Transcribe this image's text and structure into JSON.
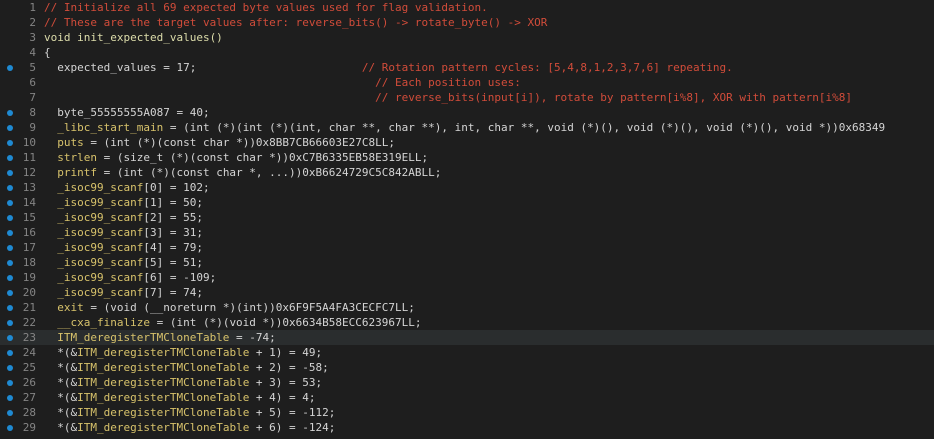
{
  "editor": {
    "lines": [
      {
        "n": "1",
        "bp": false,
        "current": false,
        "segments": [
          {
            "t": "// Initialize all 69 expected byte values used for flag validation.",
            "c": "comment"
          }
        ]
      },
      {
        "n": "2",
        "bp": false,
        "current": false,
        "segments": [
          {
            "t": "// These are the target values after: reverse_bits() -> rotate_byte() -> XOR",
            "c": "comment"
          }
        ]
      },
      {
        "n": "3",
        "bp": false,
        "current": false,
        "segments": [
          {
            "t": "void init_expected_values()",
            "c": "kw"
          }
        ]
      },
      {
        "n": "4",
        "bp": false,
        "current": false,
        "segments": [
          {
            "t": "{",
            "c": "plain"
          }
        ]
      },
      {
        "n": "5",
        "bp": true,
        "current": false,
        "segments": [
          {
            "t": "  expected_values = 17;",
            "c": "plain"
          },
          {
            "t": "                         // Rotation pattern cycles: [5,4,8,1,2,3,7,6] repeating.",
            "c": "comment"
          }
        ]
      },
      {
        "n": "6",
        "bp": false,
        "current": false,
        "segments": [
          {
            "t": "                                                  // Each position uses:",
            "c": "comment"
          }
        ]
      },
      {
        "n": "7",
        "bp": false,
        "current": false,
        "segments": [
          {
            "t": "                                                  // reverse_bits(input[i]), rotate by pattern[i%8], XOR with pattern[i%8]",
            "c": "comment"
          }
        ]
      },
      {
        "n": "8",
        "bp": true,
        "current": false,
        "segments": [
          {
            "t": "  byte_55555555A087 = 40;",
            "c": "plain"
          }
        ]
      },
      {
        "n": "9",
        "bp": true,
        "current": false,
        "segments": [
          {
            "t": "  _libc_start_main",
            "c": "sym"
          },
          {
            "t": " = (int (*)(int (*)(int, char **, char **), int, char **, void (*)(), void (*)(), void (*)(), void *))0x68349",
            "c": "plain"
          }
        ]
      },
      {
        "n": "10",
        "bp": true,
        "current": false,
        "segments": [
          {
            "t": "  puts",
            "c": "sym"
          },
          {
            "t": " = (int (*)(const char *))0x8BB7CB66603E27C8LL;",
            "c": "plain"
          }
        ]
      },
      {
        "n": "11",
        "bp": true,
        "current": false,
        "segments": [
          {
            "t": "  strlen",
            "c": "sym"
          },
          {
            "t": " = (size_t (*)(const char *))0xC7B6335EB58E319ELL;",
            "c": "plain"
          }
        ]
      },
      {
        "n": "12",
        "bp": true,
        "current": false,
        "segments": [
          {
            "t": "  printf",
            "c": "sym"
          },
          {
            "t": " = (int (*)(const char *, ...))0xB6624729C5C842ABLL;",
            "c": "plain"
          }
        ]
      },
      {
        "n": "13",
        "bp": true,
        "current": false,
        "segments": [
          {
            "t": "  _isoc99_scanf",
            "c": "sym"
          },
          {
            "t": "[0] = 102;",
            "c": "plain"
          }
        ]
      },
      {
        "n": "14",
        "bp": true,
        "current": false,
        "segments": [
          {
            "t": "  _isoc99_scanf",
            "c": "sym"
          },
          {
            "t": "[1] = 50;",
            "c": "plain"
          }
        ]
      },
      {
        "n": "15",
        "bp": true,
        "current": false,
        "segments": [
          {
            "t": "  _isoc99_scanf",
            "c": "sym"
          },
          {
            "t": "[2] = 55;",
            "c": "plain"
          }
        ]
      },
      {
        "n": "16",
        "bp": true,
        "current": false,
        "segments": [
          {
            "t": "  _isoc99_scanf",
            "c": "sym"
          },
          {
            "t": "[3] = 31;",
            "c": "plain"
          }
        ]
      },
      {
        "n": "17",
        "bp": true,
        "current": false,
        "segments": [
          {
            "t": "  _isoc99_scanf",
            "c": "sym"
          },
          {
            "t": "[4] = 79;",
            "c": "plain"
          }
        ]
      },
      {
        "n": "18",
        "bp": true,
        "current": false,
        "segments": [
          {
            "t": "  _isoc99_scanf",
            "c": "sym"
          },
          {
            "t": "[5] = 51;",
            "c": "plain"
          }
        ]
      },
      {
        "n": "19",
        "bp": true,
        "current": false,
        "segments": [
          {
            "t": "  _isoc99_scanf",
            "c": "sym"
          },
          {
            "t": "[6] = -109;",
            "c": "plain"
          }
        ]
      },
      {
        "n": "20",
        "bp": true,
        "current": false,
        "segments": [
          {
            "t": "  _isoc99_scanf",
            "c": "sym"
          },
          {
            "t": "[7] = 74;",
            "c": "plain"
          }
        ]
      },
      {
        "n": "21",
        "bp": true,
        "current": false,
        "segments": [
          {
            "t": "  exit",
            "c": "sym"
          },
          {
            "t": " = (void (__noreturn *)(int))0x6F9F5A4FA3CECFC7LL;",
            "c": "plain"
          }
        ]
      },
      {
        "n": "22",
        "bp": true,
        "current": false,
        "segments": [
          {
            "t": "  __cxa_finalize",
            "c": "sym"
          },
          {
            "t": " = (int (*)(void *))0x6634B58ECC623967LL;",
            "c": "plain"
          }
        ]
      },
      {
        "n": "23",
        "bp": true,
        "current": true,
        "segments": [
          {
            "t": "  ITM_deregisterTMCloneTable",
            "c": "sym"
          },
          {
            "t": " = -74;",
            "c": "plain"
          }
        ]
      },
      {
        "n": "24",
        "bp": true,
        "current": false,
        "segments": [
          {
            "t": "  *(&",
            "c": "plain"
          },
          {
            "t": "ITM_deregisterTMCloneTable",
            "c": "sym"
          },
          {
            "t": " + 1) = 49;",
            "c": "plain"
          }
        ]
      },
      {
        "n": "25",
        "bp": true,
        "current": false,
        "segments": [
          {
            "t": "  *(&",
            "c": "plain"
          },
          {
            "t": "ITM_deregisterTMCloneTable",
            "c": "sym"
          },
          {
            "t": " + 2) = -58;",
            "c": "plain"
          }
        ]
      },
      {
        "n": "26",
        "bp": true,
        "current": false,
        "segments": [
          {
            "t": "  *(&",
            "c": "plain"
          },
          {
            "t": "ITM_deregisterTMCloneTable",
            "c": "sym"
          },
          {
            "t": " + 3) = 53;",
            "c": "plain"
          }
        ]
      },
      {
        "n": "27",
        "bp": true,
        "current": false,
        "segments": [
          {
            "t": "  *(&",
            "c": "plain"
          },
          {
            "t": "ITM_deregisterTMCloneTable",
            "c": "sym"
          },
          {
            "t": " + 4) = 4;",
            "c": "plain"
          }
        ]
      },
      {
        "n": "28",
        "bp": true,
        "current": false,
        "segments": [
          {
            "t": "  *(&",
            "c": "plain"
          },
          {
            "t": "ITM_deregisterTMCloneTable",
            "c": "sym"
          },
          {
            "t": " + 5) = -112;",
            "c": "plain"
          }
        ]
      },
      {
        "n": "29",
        "bp": true,
        "current": false,
        "segments": [
          {
            "t": "  *(&",
            "c": "plain"
          },
          {
            "t": "ITM_deregisterTMCloneTable",
            "c": "sym"
          },
          {
            "t": " + 6) = -124;",
            "c": "plain"
          }
        ]
      }
    ]
  },
  "colors": {
    "background": "#1e1e1e",
    "comment": "#d14c3a",
    "symbol": "#d7c26b",
    "keyword": "#dcdcaa",
    "line_number": "#858585",
    "breakpoint": "#1f8ad2"
  },
  "icons": {
    "breakpoint": "breakpoint-dot-icon"
  }
}
